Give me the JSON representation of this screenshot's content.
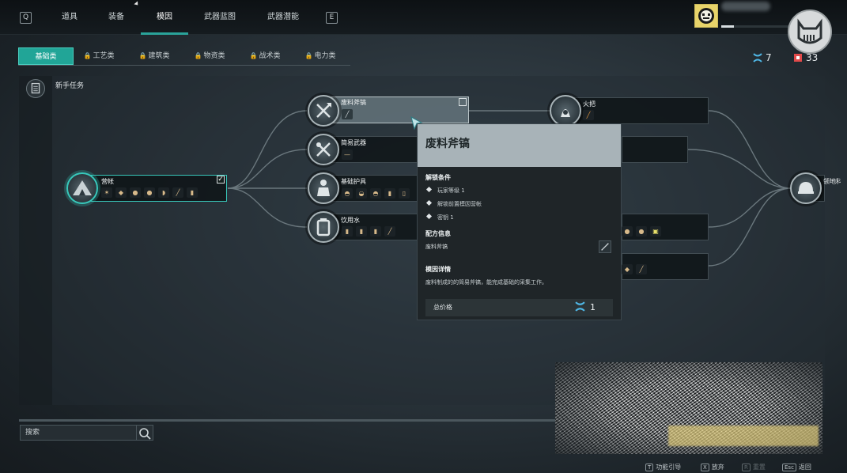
{
  "topbar": {
    "left_key": "Q",
    "right_key": "E",
    "tabs": [
      "道具",
      "装备",
      "模因",
      "武器蓝图",
      "武器潜能"
    ],
    "active_tab": "模因"
  },
  "subtabs": [
    {
      "label": "基础类",
      "locked": false
    },
    {
      "label": "工艺类",
      "locked": true
    },
    {
      "label": "建筑类",
      "locked": true
    },
    {
      "label": "物资类",
      "locked": true
    },
    {
      "label": "战术类",
      "locked": true
    },
    {
      "label": "电力类",
      "locked": true
    }
  ],
  "currency": {
    "meme_points": "7",
    "chips": "33",
    "meme_color": "#4fb7e6",
    "chip_color": "#e24a4a"
  },
  "section": {
    "label": "新手任务"
  },
  "nodes": {
    "camp": {
      "title": "营帐",
      "checked": true,
      "icon": "tent-icon"
    },
    "scrap_axe": {
      "title": "废料斧镐",
      "icon": "axe-pickaxe-icon"
    },
    "simple_weapon": {
      "title": "简易武器",
      "icon": "crossed-weapons-icon"
    },
    "basic_armor": {
      "title": "基础护具",
      "icon": "armor-icon"
    },
    "drink_water": {
      "title": "饮用水",
      "icon": "water-container-icon"
    },
    "torch": {
      "title": "火把",
      "icon": "torch-icon"
    },
    "territory": {
      "title": "领地科",
      "icon": "helmet-icon"
    }
  },
  "tooltip": {
    "title": "废料斧镐",
    "unlock_header": "解锁条件",
    "conditions": [
      "玩家等级 1",
      "解锁前置模因营帐",
      "密钥 1"
    ],
    "recipe_header": "配方信息",
    "recipe_item": "废料斧镐",
    "detail_header": "模因详情",
    "detail_text": "废料制成的的简易斧镐，能完成基础的采集工作。",
    "total_label": "总价格",
    "total_value": "1"
  },
  "search": {
    "placeholder": "搜索"
  },
  "hints": [
    {
      "key": "T",
      "label": "功能引导",
      "dim": false
    },
    {
      "key": "X",
      "label": "放弃",
      "dim": false
    },
    {
      "key": "R",
      "label": "重置",
      "dim": true
    },
    {
      "key": "Esc",
      "label": "返回",
      "dim": false
    }
  ],
  "colors": {
    "accent": "#21a597",
    "tooltip_header": "#a8b3b8"
  }
}
